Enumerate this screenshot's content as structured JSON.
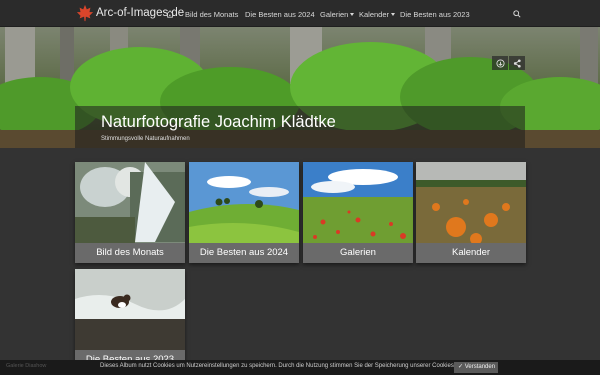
{
  "nav": {
    "brand": "Arc-of-Images.de",
    "items": [
      {
        "label": "Bild des Monats",
        "dropdown": false
      },
      {
        "label": "Die Besten aus 2024",
        "dropdown": false
      },
      {
        "label": "Galerien",
        "dropdown": true
      },
      {
        "label": "Kalender",
        "dropdown": true
      },
      {
        "label": "Die Besten aus 2023",
        "dropdown": false
      }
    ],
    "icons": {
      "home": "home-icon",
      "search": "search-icon",
      "logo": "maple-leaf-icon"
    }
  },
  "hero": {
    "title": "Naturfotografie Joachim Klädtke",
    "subtitle": "Stimmungsvolle Naturaufnahmen",
    "buttons": [
      "download-icon",
      "share-icon"
    ]
  },
  "tiles": [
    {
      "label": "Bild des Monats",
      "image": "icy-creek"
    },
    {
      "label": "Die Besten aus 2024",
      "image": "green-hills"
    },
    {
      "label": "Galerien",
      "image": "poppy-field"
    },
    {
      "label": "Kalender",
      "image": "pumpkin-field"
    },
    {
      "label": "Die Besten aus 2023",
      "image": "dipper-bird-on-rock"
    }
  ],
  "cookie": {
    "text": "Dieses Album nutzt Cookies um Nutzereinstellungen zu speichern. Durch die Nutzung stimmen Sie der Speicherung unserer Cookies zu.",
    "accept_label": "Verstanden",
    "left_text": "Galerie   Diashow"
  },
  "colors": {
    "navbar": "#2b2b2b",
    "page_bg": "#333333",
    "tile_label_bg": "#6a6a6a",
    "cookie_bg": "#1a1a1a"
  }
}
